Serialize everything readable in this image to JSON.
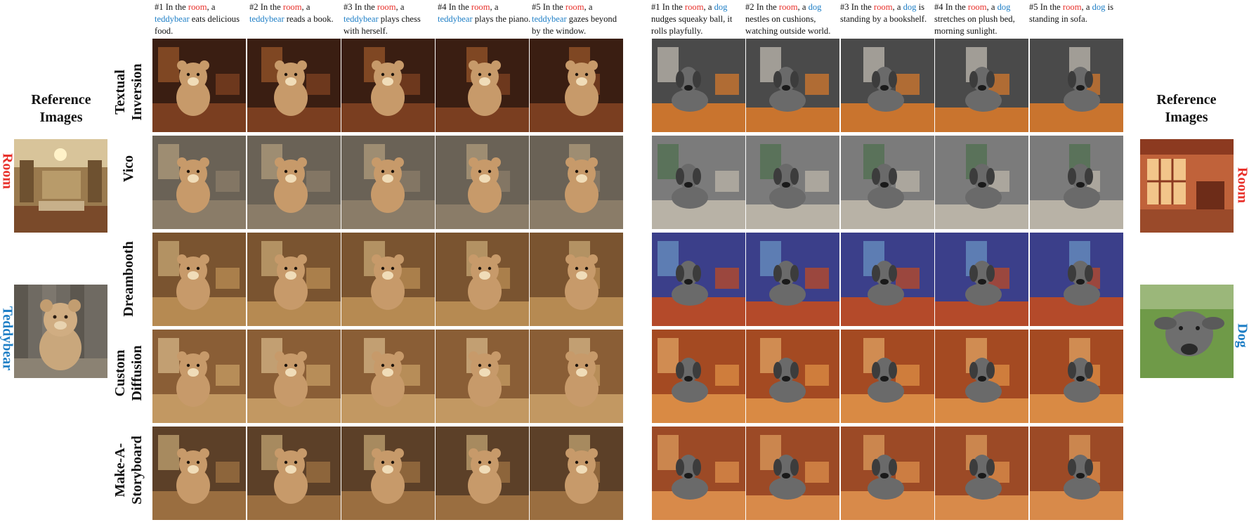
{
  "figure": {
    "teddy_prompts": [
      {
        "n": "#1 In the ",
        "w1": "room",
        "m": ", a ",
        "w2": "teddybear",
        "rest": " eats delicious food."
      },
      {
        "n": "#2 In the ",
        "w1": "room",
        "m": ", a ",
        "w2": "teddybear",
        "rest": " reads a book."
      },
      {
        "n": "#3 In the ",
        "w1": "room",
        "m": ", a ",
        "w2": "teddybear",
        "rest": " plays chess with herself."
      },
      {
        "n": "#4 In the ",
        "w1": "room",
        "m": ", a ",
        "w2": "teddybear",
        "rest": " plays the piano."
      },
      {
        "n": "#5 In the ",
        "w1": "room",
        "m": ", a ",
        "w2": "teddybear",
        "rest": " gazes beyond by the window."
      }
    ],
    "dog_prompts": [
      {
        "n": "#1 In the ",
        "w1": "room",
        "m": ", a ",
        "w2": "dog",
        "rest": " nudges squeaky ball, it rolls playfully."
      },
      {
        "n": "#2 In the ",
        "w1": "room",
        "m": ", a ",
        "w2": "dog",
        "rest": " nestles on cushions, watching outside world."
      },
      {
        "n": "#3 In the ",
        "w1": "room",
        "m": ", a ",
        "w2": "dog",
        "rest": " is standing by a bookshelf."
      },
      {
        "n": "#4 In the ",
        "w1": "room",
        "m": ", a ",
        "w2": "dog",
        "rest": " stretches on plush bed, morning sunlight."
      },
      {
        "n": "#5 In the ",
        "w1": "room",
        "m": ", a ",
        "w2": "dog",
        "rest": " is standing in sofa."
      }
    ],
    "left_reference": {
      "heading": "Reference Images",
      "label_top": "Room",
      "label_bottom": "Teddybear"
    },
    "right_reference": {
      "heading": "Reference Images",
      "label_top": "Room",
      "label_bottom": "Dog"
    },
    "methods": [
      "Textual Inversion",
      "Vico",
      "Dreambooth",
      "Custom Diffusion",
      "Make-A-Storyboard"
    ],
    "colors": {
      "highlight_room": "#e8322c",
      "highlight_subject": "#1f7fc6"
    }
  }
}
